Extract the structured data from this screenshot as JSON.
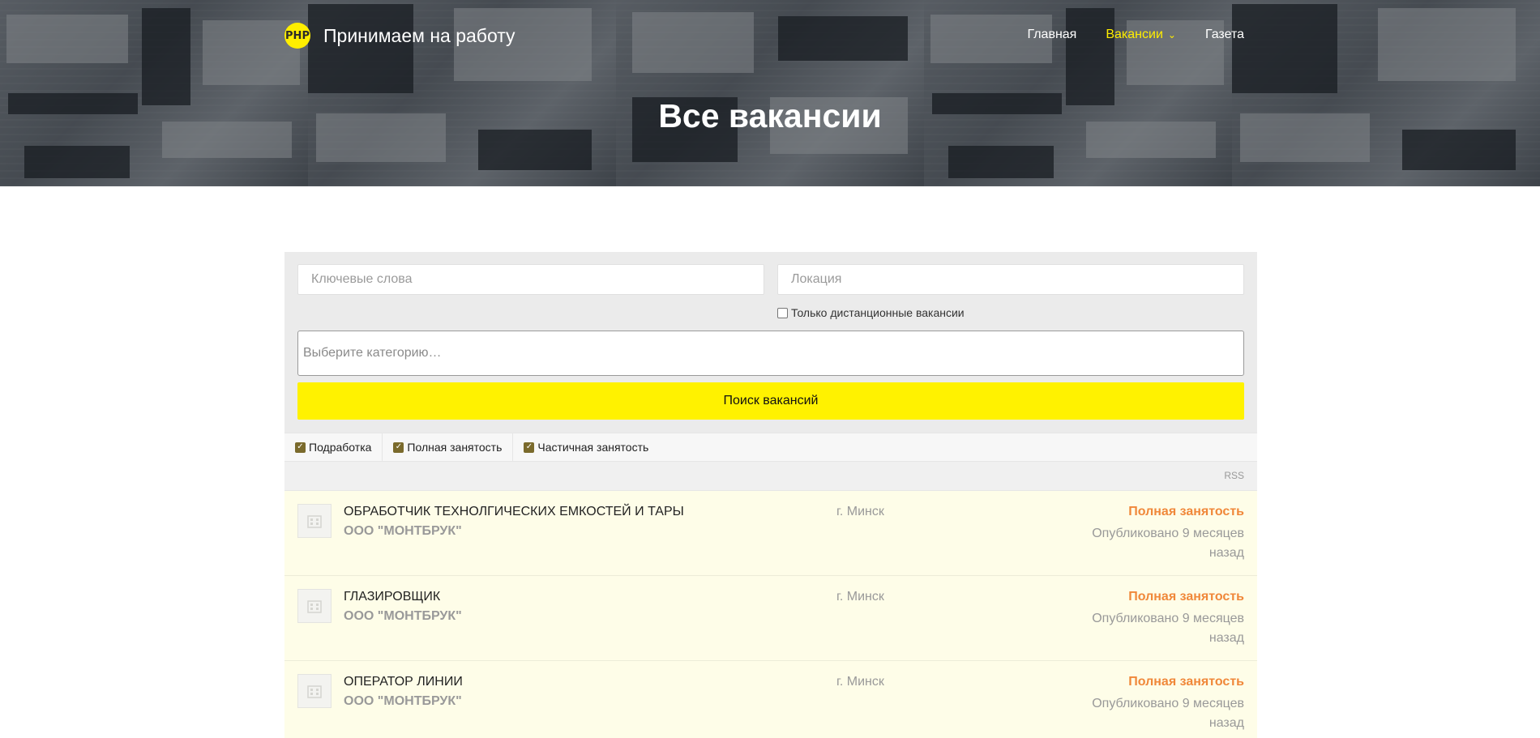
{
  "header": {
    "logo_text": "РНР",
    "site_title": "Принимаем на работу",
    "nav": [
      {
        "label": "Главная",
        "active": false
      },
      {
        "label": "Вакансии",
        "active": true,
        "has_dropdown": true
      },
      {
        "label": "Газета",
        "active": false
      }
    ],
    "page_title": "Все вакансии"
  },
  "search": {
    "keywords_placeholder": "Ключевые слова",
    "location_placeholder": "Локация",
    "remote_label": "Только дистанционные вакансии",
    "remote_checked": false,
    "category_placeholder": "Выберите категорию…",
    "submit_label": "Поиск вакансий"
  },
  "filters": [
    {
      "label": "Подработка",
      "checked": true
    },
    {
      "label": "Полная занятость",
      "checked": true
    },
    {
      "label": "Частичная занятость",
      "checked": true
    }
  ],
  "rss_label": "RSS",
  "listings": [
    {
      "title": "Обработчик технолгических емкостей и тары",
      "company": "ООО \"МОНТБРУК\"",
      "location": "г. Минск",
      "type": "Полная занятость",
      "date": "Опубликовано 9 месяцев назад"
    },
    {
      "title": "Глазировщик",
      "company": "ООО \"МОНТБРУК\"",
      "location": "г. Минск",
      "type": "Полная занятость",
      "date": "Опубликовано 9 месяцев назад"
    },
    {
      "title": "Оператор линии",
      "company": "ООО \"МОНТБРУК\"",
      "location": "г. Минск",
      "type": "Полная занятость",
      "date": "Опубликовано 9 месяцев назад"
    }
  ],
  "colors": {
    "accent_yellow": "#fff200",
    "job_type_orange": "#f0883a",
    "listing_bg": "#fefde8"
  }
}
